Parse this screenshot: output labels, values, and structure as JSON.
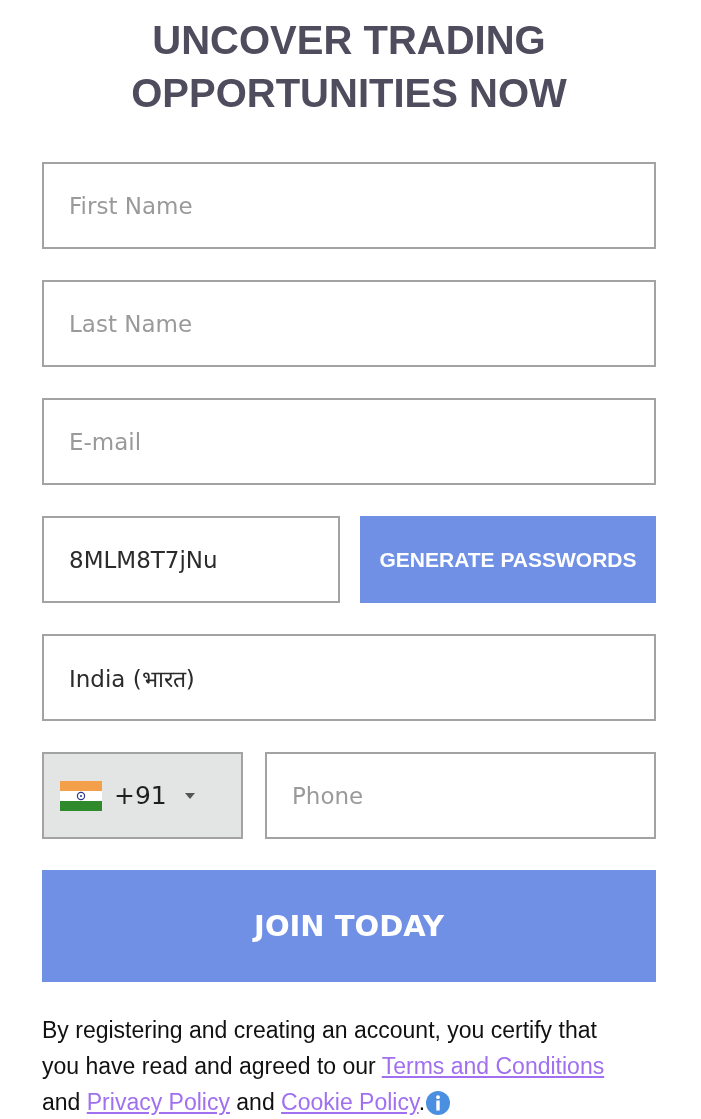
{
  "heading": "UNCOVER TRADING OPPORTUNITIES NOW",
  "form": {
    "fields": [
      {
        "kind": "text",
        "placeholder": "First Name"
      },
      {
        "kind": "text",
        "placeholder": "Last Name"
      },
      {
        "kind": "text",
        "placeholder": "E-mail"
      },
      {
        "kind": "password",
        "value": "8MLM8T7jNu",
        "button": "GENERATE PASSWORDS"
      },
      {
        "kind": "select",
        "value": "India (भारत)"
      },
      {
        "kind": "phone",
        "dial_code": "+91",
        "placeholder": "Phone"
      }
    ],
    "submit": "JOIN TODAY"
  },
  "legal": [
    {
      "kind": "text",
      "text": "By registering and creating an account, you certify that you have read and agreed to our "
    },
    {
      "kind": "link",
      "text": "Terms and Conditions"
    },
    {
      "kind": "text",
      "text": " and "
    },
    {
      "kind": "link",
      "text": "Privacy Policy"
    },
    {
      "kind": "text",
      "text": " and "
    },
    {
      "kind": "link",
      "text": "Cookie Policy"
    },
    {
      "kind": "text",
      "text": "."
    },
    {
      "kind": "info"
    }
  ]
}
